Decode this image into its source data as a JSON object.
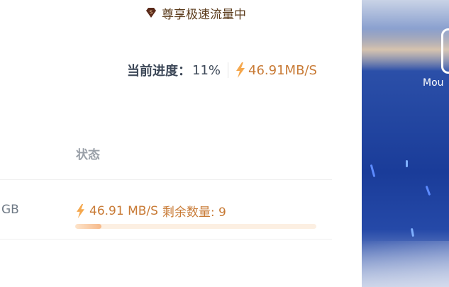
{
  "banner": {
    "text": "尊享极速流量中",
    "icon": "vip-diamond-icon",
    "badge": "S"
  },
  "progress": {
    "label": "当前进度：",
    "value": "11%",
    "speed": "46.91MB/S"
  },
  "table": {
    "status_header": "状态",
    "row": {
      "size_fragment": "GB",
      "speed": "46.91 MB/S",
      "remaining": "剩余数量: 9",
      "progress_fraction": 0.11
    }
  },
  "side": {
    "label_fragment": "Mou"
  },
  "colors": {
    "accent": "#c87a35",
    "bar_track": "#fcefe2",
    "bar_fill": "#f6b98a"
  }
}
